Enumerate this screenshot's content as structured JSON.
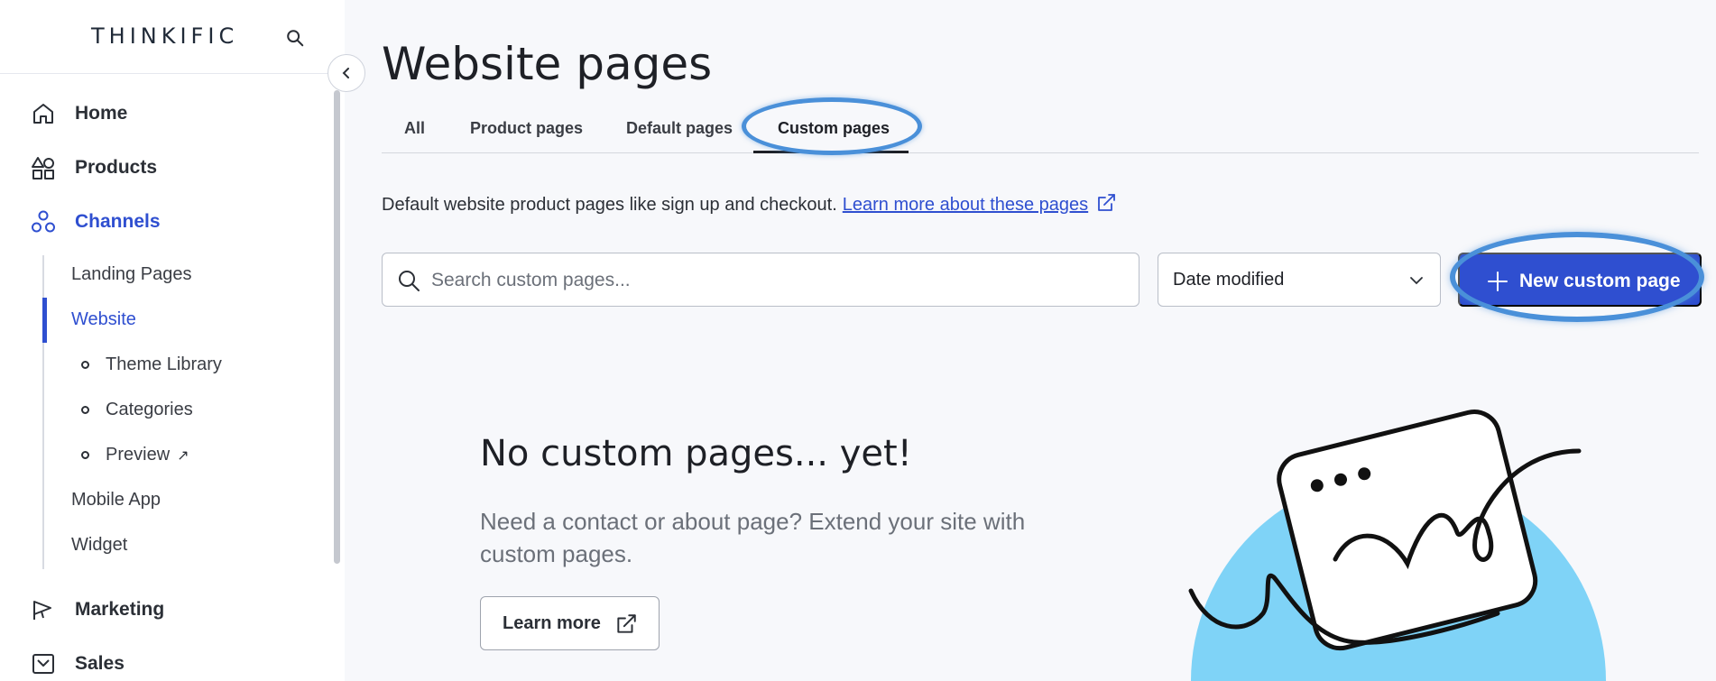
{
  "sidebar": {
    "logo": "THINKIFIC",
    "nav": [
      {
        "label": "Home",
        "icon": "home-icon"
      },
      {
        "label": "Products",
        "icon": "shapes-icon"
      },
      {
        "label": "Channels",
        "icon": "channels-icon",
        "active": true
      },
      {
        "label": "Marketing",
        "icon": "megaphone-icon"
      },
      {
        "label": "Sales",
        "icon": "sales-icon"
      }
    ],
    "sub": {
      "landing_pages": "Landing Pages",
      "website": "Website",
      "theme_library": "Theme Library",
      "categories": "Categories",
      "preview": "Preview",
      "mobile_app": "Mobile App",
      "widget": "Widget"
    }
  },
  "main": {
    "title": "Website pages",
    "tabs": [
      {
        "label": "All"
      },
      {
        "label": "Product pages"
      },
      {
        "label": "Default pages"
      },
      {
        "label": "Custom pages",
        "active": true
      }
    ],
    "description": "Default website product pages like sign up and checkout.",
    "learn_link": "Learn more about these pages",
    "search_placeholder": "Search custom pages...",
    "sort_value": "Date modified",
    "new_button": "New custom page",
    "empty": {
      "title": "No custom pages... yet!",
      "text": "Need a contact or about page? Extend your site with custom pages.",
      "learn_more": "Learn more"
    }
  },
  "colors": {
    "accent": "#2f4fd0",
    "highlight_ring": "#4a90d9",
    "illustration_blue": "#7fd3f7"
  }
}
